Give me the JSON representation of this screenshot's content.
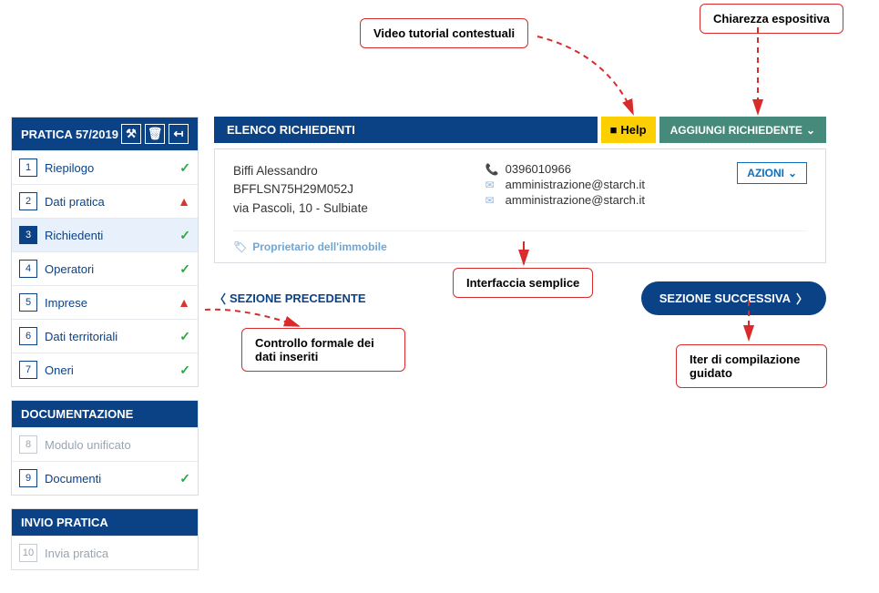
{
  "sidebar": {
    "practice": {
      "title": "PRATICA 57/2019"
    },
    "items": [
      {
        "num": "1",
        "label": "Riepilogo",
        "status": "check"
      },
      {
        "num": "2",
        "label": "Dati pratica",
        "status": "warn"
      },
      {
        "num": "3",
        "label": "Richiedenti",
        "status": "check",
        "active": true
      },
      {
        "num": "4",
        "label": "Operatori",
        "status": "check"
      },
      {
        "num": "5",
        "label": "Imprese",
        "status": "warn"
      },
      {
        "num": "6",
        "label": "Dati territoriali",
        "status": "check"
      },
      {
        "num": "7",
        "label": "Oneri",
        "status": "check"
      }
    ],
    "doc": {
      "title": "DOCUMENTAZIONE",
      "items": [
        {
          "num": "8",
          "label": "Modulo unificato",
          "disabled": true
        },
        {
          "num": "9",
          "label": "Documenti",
          "status": "check"
        }
      ]
    },
    "send": {
      "title": "INVIO PRATICA",
      "items": [
        {
          "num": "10",
          "label": "Invia pratica",
          "disabled": true
        }
      ]
    }
  },
  "panel": {
    "title": "ELENCO RICHIEDENTI",
    "help": "Help",
    "add": "AGGIUNGI RICHIEDENTE"
  },
  "applicant": {
    "name": "Biffi Alessandro",
    "code": "BFFLSN75H29M052J",
    "address": "via Pascoli, 10 - Sulbiate",
    "phone": "0396010966",
    "email1": "amministrazione@starch.it",
    "email2": "amministrazione@starch.it",
    "owner_tag": "Proprietario dell'immobile",
    "actions": "AZIONI"
  },
  "nav": {
    "prev": "SEZIONE PRECEDENTE",
    "next": "SEZIONE SUCCESSIVA"
  },
  "callouts": {
    "tutorial": "Video tutorial contestuali",
    "clarity": "Chiarezza espositiva",
    "simple": "Interfaccia semplice",
    "guided": "Iter di compilazione guidato",
    "validation": "Controllo formale dei dati inseriti"
  }
}
